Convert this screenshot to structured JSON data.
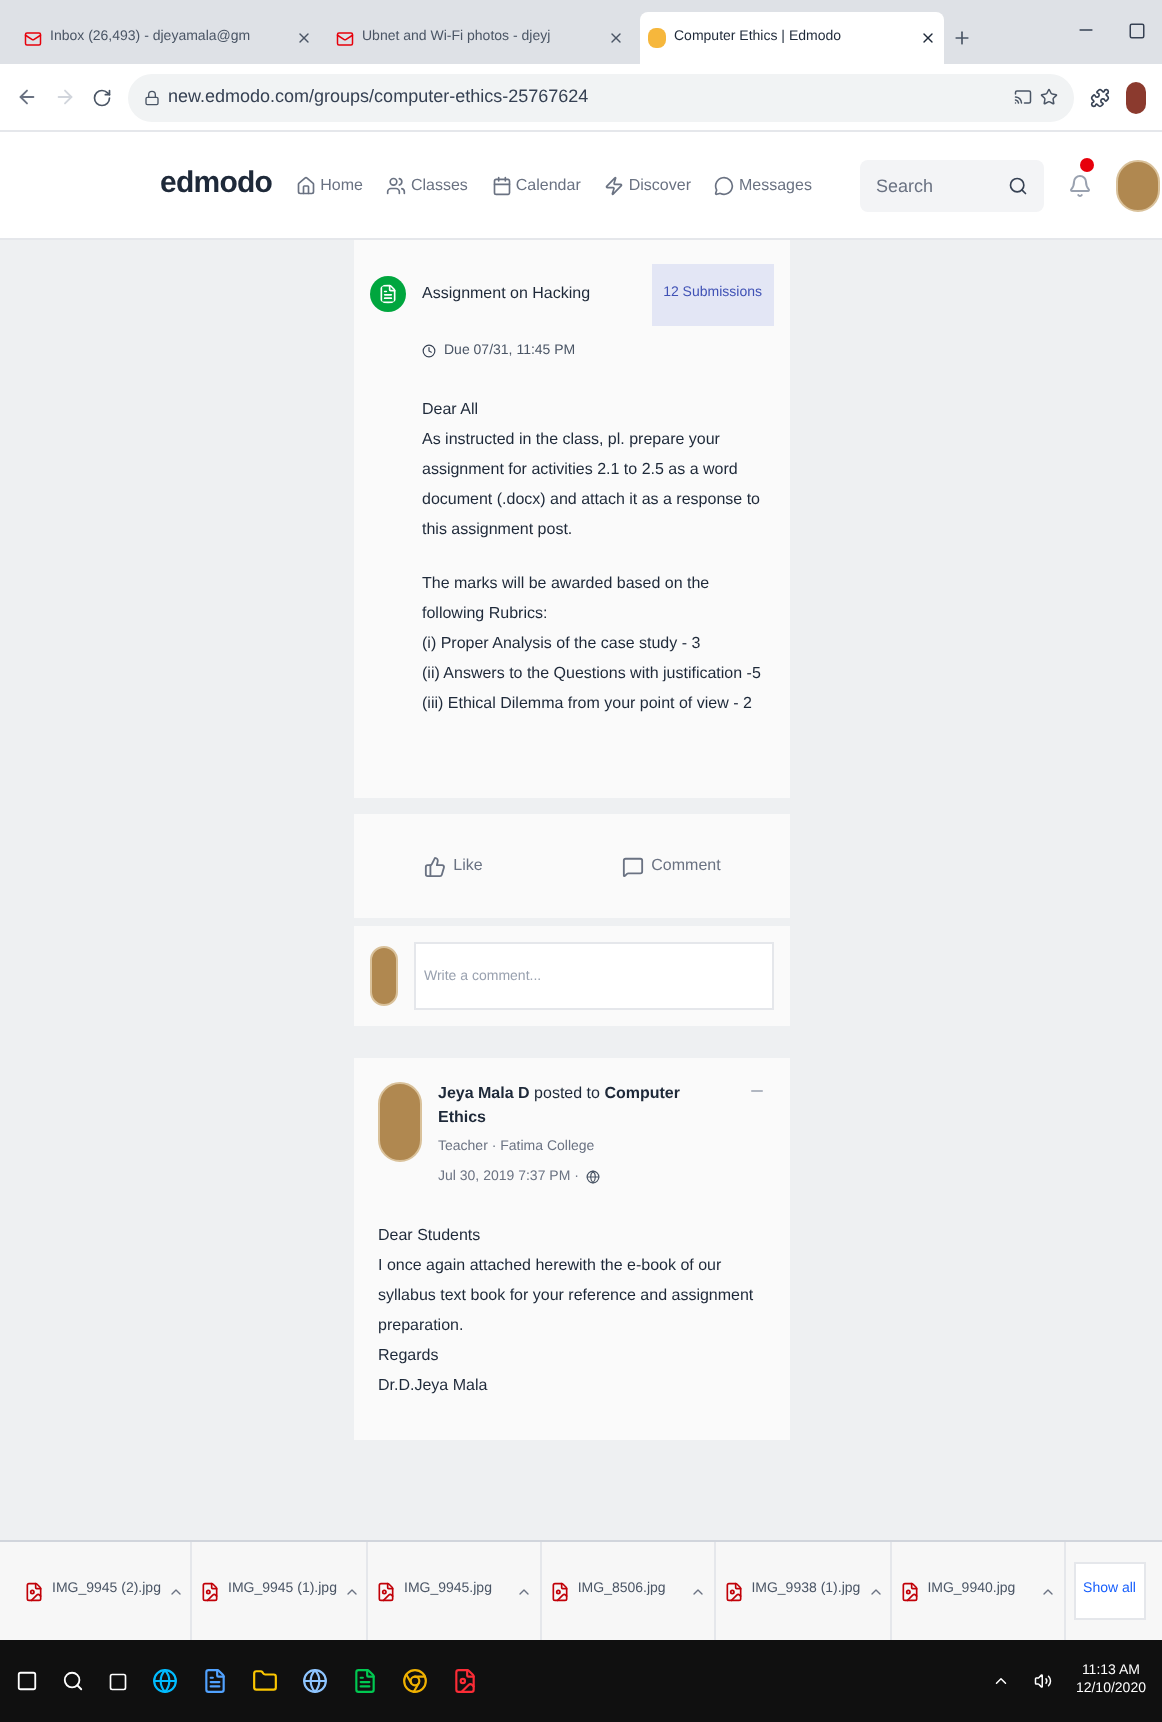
{
  "browser": {
    "tabs": [
      {
        "title": "Inbox (26,493) - djeyamala@gm",
        "selected": false
      },
      {
        "title": "Ubnet and Wi-Fi photos - djeyj",
        "selected": false
      },
      {
        "title": "Computer Ethics | Edmodo",
        "selected": true
      }
    ],
    "url": "new.edmodo.com/groups/computer-ethics-25767624"
  },
  "header": {
    "logo": "edmodo",
    "nav": [
      "Home",
      "Classes",
      "Calendar",
      "Discover",
      "Messages"
    ],
    "search": {
      "placeholder": "Search"
    }
  },
  "assignment": {
    "title": "Assignment on Hacking",
    "submissions": "12 Submissions",
    "due": "Due 07/31, 11:45 PM",
    "paragraphs": [
      [
        "Dear All",
        "As instructed in the class, pl. prepare your assignment for activities 2.1 to 2.5 as a word document (.docx) and attach it as a response to this assignment post."
      ],
      [
        "The marks will be awarded based on the following Rubrics:",
        "(i) Proper Analysis of the case study - 3",
        "(ii) Answers to the Questions with justification -5",
        "(iii) Ethical Dilemma from your point of view - 2"
      ]
    ],
    "actions": [
      "Like",
      "Comment"
    ],
    "comment_placeholder": "Write a comment..."
  },
  "post": {
    "author": "Jeya Mala D",
    "posted_to": "posted to",
    "group": "Computer Ethics",
    "role": "Teacher · Fatima College",
    "time": "Jul 30, 2019 7:37 PM ·",
    "lines": [
      "Dear Students",
      "I once again attached herewith the e-book of our syllabus text book for your reference and assignment preparation.",
      "Regards",
      "Dr.D.Jeya Mala"
    ]
  },
  "downloads": {
    "files": [
      "IMG_9945 (2).jpg",
      "IMG_9945 (1).jpg",
      "IMG_9945.jpg",
      "IMG_8506.jpg",
      "IMG_9938 (1).jpg",
      "IMG_9940.jpg"
    ],
    "show_all": "Show all"
  },
  "taskbar": {
    "time": "11:13 AM",
    "date": "12/10/2020"
  }
}
